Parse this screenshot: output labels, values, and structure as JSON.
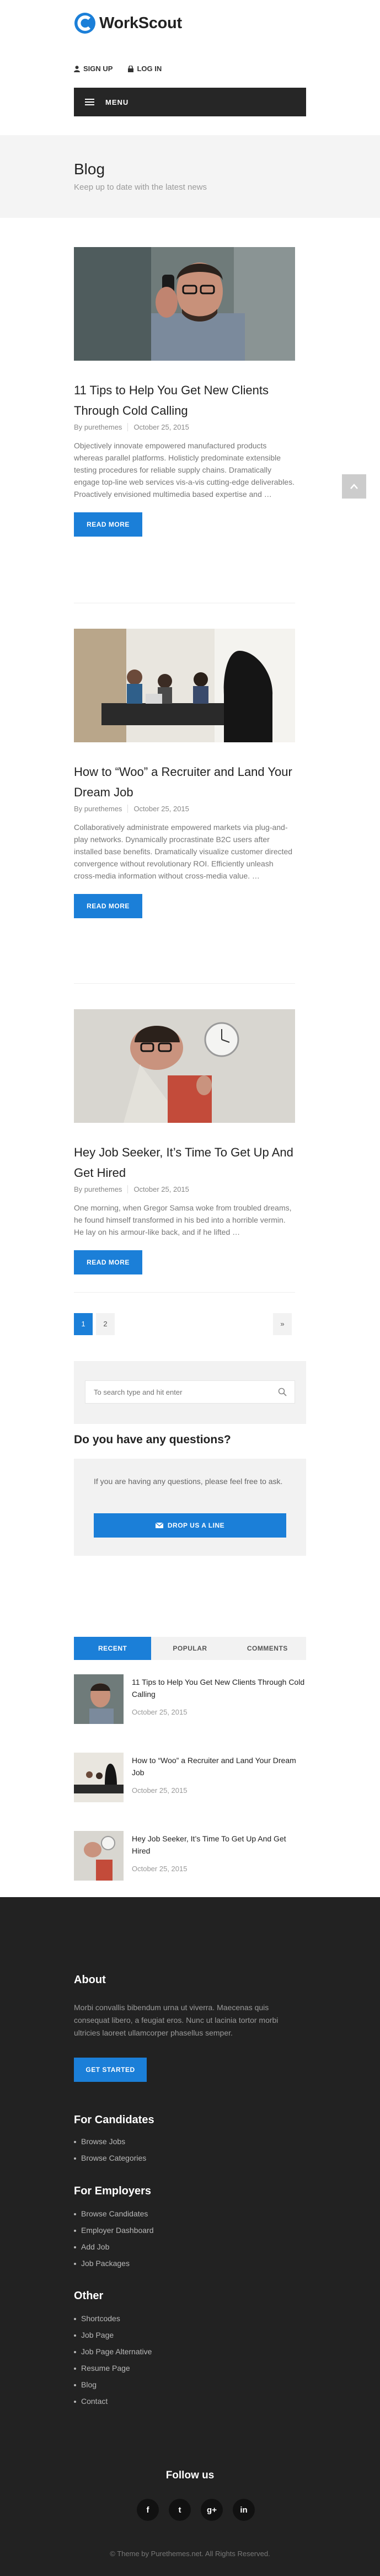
{
  "brand": {
    "name": "WorkScout",
    "accent": "#1b7fd8"
  },
  "topbar": {
    "sign_up": "SIGN UP",
    "log_in": "LOG IN"
  },
  "menu": {
    "label": "MENU"
  },
  "titlebar": {
    "title": "Blog",
    "subtitle": "Keep up to date with the latest news"
  },
  "posts": [
    {
      "title": "11 Tips to Help You Get New Clients Through Cold Calling",
      "author": "By purethemes",
      "date": "October 25, 2015",
      "excerpt": "Objectively innovate empowered manufactured products whereas parallel platforms. Holisticly predominate extensible testing procedures for reliable supply chains. Dramatically engage top-line web services vis-a-vis cutting-edge deliverables. Proactively envisioned multimedia based expertise and …",
      "read_more": "READ MORE"
    },
    {
      "title": "How to “Woo” a Recruiter and Land Your Dream Job",
      "author": "By purethemes",
      "date": "October 25, 2015",
      "excerpt": "Collaboratively administrate empowered markets via plug-and-play networks. Dynamically procrastinate B2C users after installed base benefits. Dramatically visualize customer directed convergence without revolutionary ROI. Efficiently unleash cross-media information without cross-media value. …",
      "read_more": "READ MORE"
    },
    {
      "title": "Hey Job Seeker, It’s Time To Get Up And Get Hired",
      "author": "By purethemes",
      "date": "October 25, 2015",
      "excerpt": "One morning, when Gregor Samsa woke from troubled dreams, he found himself transformed in his bed into a horrible vermin. He lay on his armour-like back, and if he lifted …",
      "read_more": "READ MORE"
    }
  ],
  "pagination": {
    "pages": [
      "1",
      "2"
    ],
    "next": "»"
  },
  "search": {
    "placeholder": "To search type and hit enter"
  },
  "questions": {
    "title": "Do you have any questions?",
    "text": "If you are having any questions, please feel free to ask.",
    "button": "DROP US A LINE"
  },
  "tabs": {
    "recent": "RECENT",
    "popular": "POPULAR",
    "comments": "COMMENTS"
  },
  "recent": [
    {
      "title": "11 Tips to Help You Get New Clients Through Cold Calling",
      "date": "October 25, 2015"
    },
    {
      "title": "How to “Woo” a Recruiter and Land Your Dream Job",
      "date": "October 25, 2015"
    },
    {
      "title": "Hey Job Seeker, It’s Time To Get Up And Get Hired",
      "date": "October 25, 2015"
    }
  ],
  "footer": {
    "about_title": "About",
    "about_text": "Morbi convallis bibendum urna ut viverra. Maecenas quis consequat libero, a feugiat eros. Nunc ut lacinia tortor morbi ultricies laoreet ullamcorper phasellus semper.",
    "get_started": "GET STARTED",
    "candidates_title": "For Candidates",
    "candidates": [
      "Browse Jobs",
      "Browse Categories"
    ],
    "employers_title": "For Employers",
    "employers": [
      "Browse Candidates",
      "Employer Dashboard",
      "Add Job",
      "Job Packages"
    ],
    "other_title": "Other",
    "other": [
      "Shortcodes",
      "Job Page",
      "Job Page Alternative",
      "Resume Page",
      "Blog",
      "Contact"
    ],
    "follow": "Follow us",
    "socials": [
      "f",
      "t",
      "g+",
      "in"
    ],
    "copyright": "© Theme by Purethemes.net. All Rights Reserved."
  }
}
